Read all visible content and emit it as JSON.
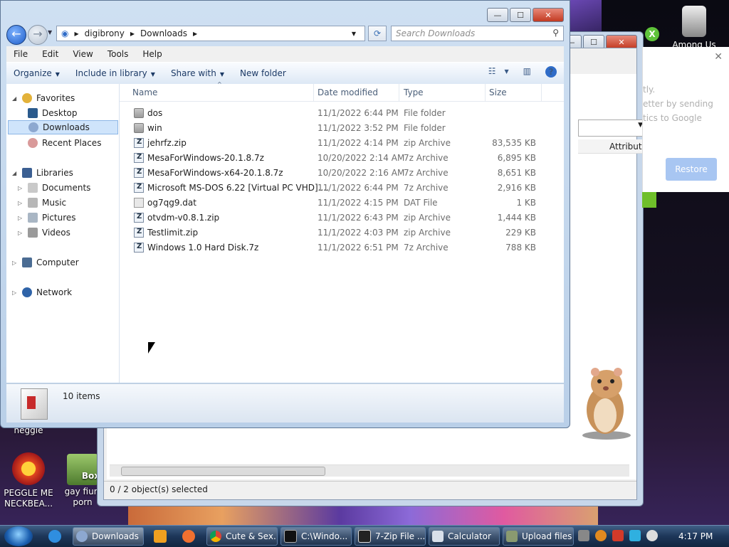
{
  "desktop": {
    "icons": [
      {
        "label": "heggle"
      },
      {
        "label": "PEGGLE ME NECKBEA..."
      },
      {
        "label": "gay fiurr porn"
      },
      {
        "label": "Among Us"
      }
    ],
    "box_label": "Box"
  },
  "back_window": {
    "column": "Attribute",
    "status": "0 / 2 object(s) selected"
  },
  "chrome_panel": {
    "text_lines": [
      "tly.",
      "etter by sending",
      "tics to Google"
    ],
    "restore_label": "Restore",
    "close_glyph": "✕"
  },
  "explorer": {
    "address": {
      "crumbs": [
        "digibrony",
        "Downloads"
      ],
      "search_placeholder": "Search Downloads"
    },
    "menu": [
      "File",
      "Edit",
      "View",
      "Tools",
      "Help"
    ],
    "commands": [
      "Organize",
      "Include in library",
      "Share with",
      "New folder"
    ],
    "nav": {
      "favorites": {
        "label": "Favorites",
        "items": [
          "Desktop",
          "Downloads",
          "Recent Places"
        ]
      },
      "libraries": {
        "label": "Libraries",
        "items": [
          "Documents",
          "Music",
          "Pictures",
          "Videos"
        ]
      },
      "computer": "Computer",
      "network": "Network",
      "selected": "Downloads"
    },
    "columns": [
      "Name",
      "Date modified",
      "Type",
      "Size"
    ],
    "files": [
      {
        "name": "dos",
        "date": "11/1/2022 6:44 PM",
        "type": "File folder",
        "size": "",
        "kind": "folder"
      },
      {
        "name": "win",
        "date": "11/1/2022 3:52 PM",
        "type": "File folder",
        "size": "",
        "kind": "folder"
      },
      {
        "name": "jehrfz.zip",
        "date": "11/1/2022 4:14 PM",
        "type": "zip Archive",
        "size": "83,535 KB",
        "kind": "zip"
      },
      {
        "name": "MesaForWindows-20.1.8.7z",
        "date": "10/20/2022 2:14 AM",
        "type": "7z Archive",
        "size": "6,895 KB",
        "kind": "zip"
      },
      {
        "name": "MesaForWindows-x64-20.1.8.7z",
        "date": "10/20/2022 2:16 AM",
        "type": "7z Archive",
        "size": "8,651 KB",
        "kind": "zip"
      },
      {
        "name": "Microsoft MS-DOS 6.22 [Virtual PC VHD]....",
        "date": "11/1/2022 6:44 PM",
        "type": "7z Archive",
        "size": "2,916 KB",
        "kind": "zip"
      },
      {
        "name": "og7qg9.dat",
        "date": "11/1/2022 4:15 PM",
        "type": "DAT File",
        "size": "1 KB",
        "kind": "dat"
      },
      {
        "name": "otvdm-v0.8.1.zip",
        "date": "11/1/2022 6:43 PM",
        "type": "zip Archive",
        "size": "1,444 KB",
        "kind": "zip"
      },
      {
        "name": "Testlimit.zip",
        "date": "11/1/2022 4:03 PM",
        "type": "zip Archive",
        "size": "229 KB",
        "kind": "zip"
      },
      {
        "name": "Windows 1.0 Hard Disk.7z",
        "date": "11/1/2022 6:51 PM",
        "type": "7z Archive",
        "size": "788 KB",
        "kind": "zip"
      }
    ],
    "item_count": "10 items"
  },
  "taskbar": {
    "buttons": [
      "Downloads",
      "Cute & Sex...",
      "C:\\Windo...",
      "7-Zip File ...",
      "Calculator",
      "Upload files"
    ],
    "clock": "4:17 PM"
  }
}
